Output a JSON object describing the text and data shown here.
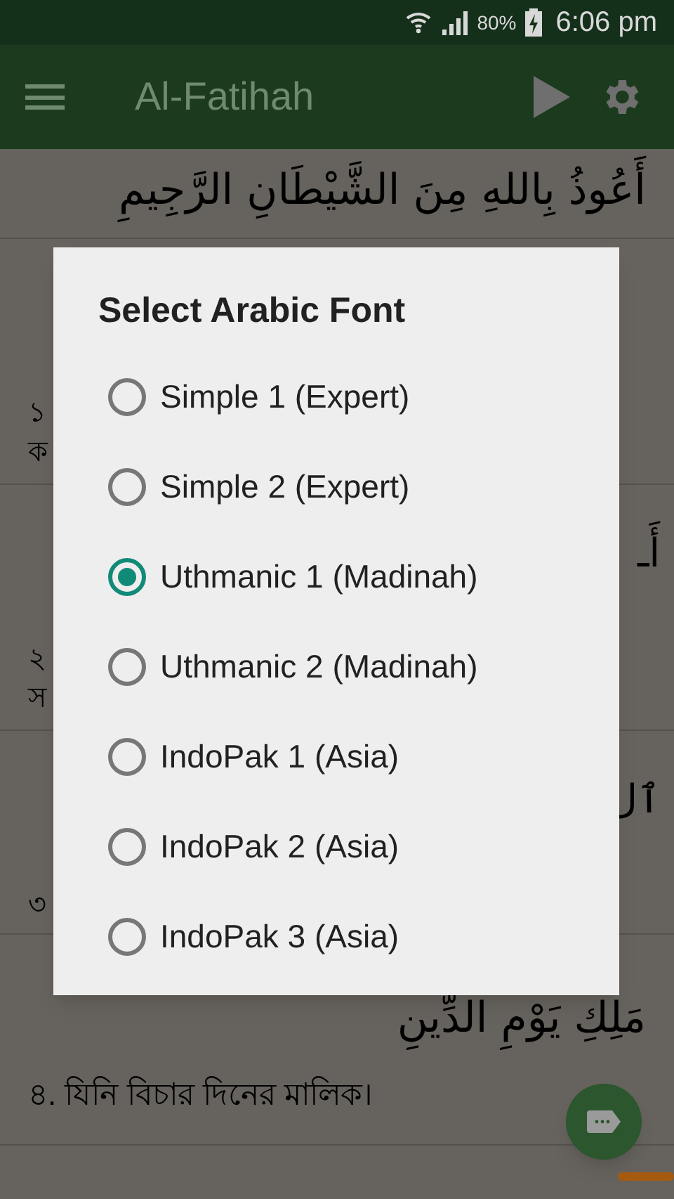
{
  "status_bar": {
    "battery": "80%",
    "time": "6:06 pm"
  },
  "app_bar": {
    "title": "Al-Fatihah"
  },
  "rows": [
    {
      "arabic": "أَعُوذُ بِاللهِ مِنَ الشَّيْطَانِ الرَّجِيمِ"
    },
    {
      "left_fragments": [
        "১",
        "ক"
      ]
    },
    {
      "right_fragment": "أَـ",
      "left_fragments": [
        "২",
        "স"
      ]
    },
    {
      "right_fragment": "ٱل",
      "left_fragments": [
        "৩"
      ]
    },
    {
      "arabic": "مَلِكِ يَوْمِ الدِّينِ",
      "translation": "৪. যিনি বিচার দিনের মালিক।"
    }
  ],
  "dialog": {
    "title": "Select Arabic Font",
    "options": [
      {
        "label": "Simple 1 (Expert)",
        "selected": false
      },
      {
        "label": "Simple 2 (Expert)",
        "selected": false
      },
      {
        "label": "Uthmanic 1 (Madinah)",
        "selected": true
      },
      {
        "label": "Uthmanic 2 (Madinah)",
        "selected": false
      },
      {
        "label": "IndoPak 1 (Asia)",
        "selected": false
      },
      {
        "label": "IndoPak 2 (Asia)",
        "selected": false
      },
      {
        "label": "IndoPak 3 (Asia)",
        "selected": false
      }
    ]
  }
}
